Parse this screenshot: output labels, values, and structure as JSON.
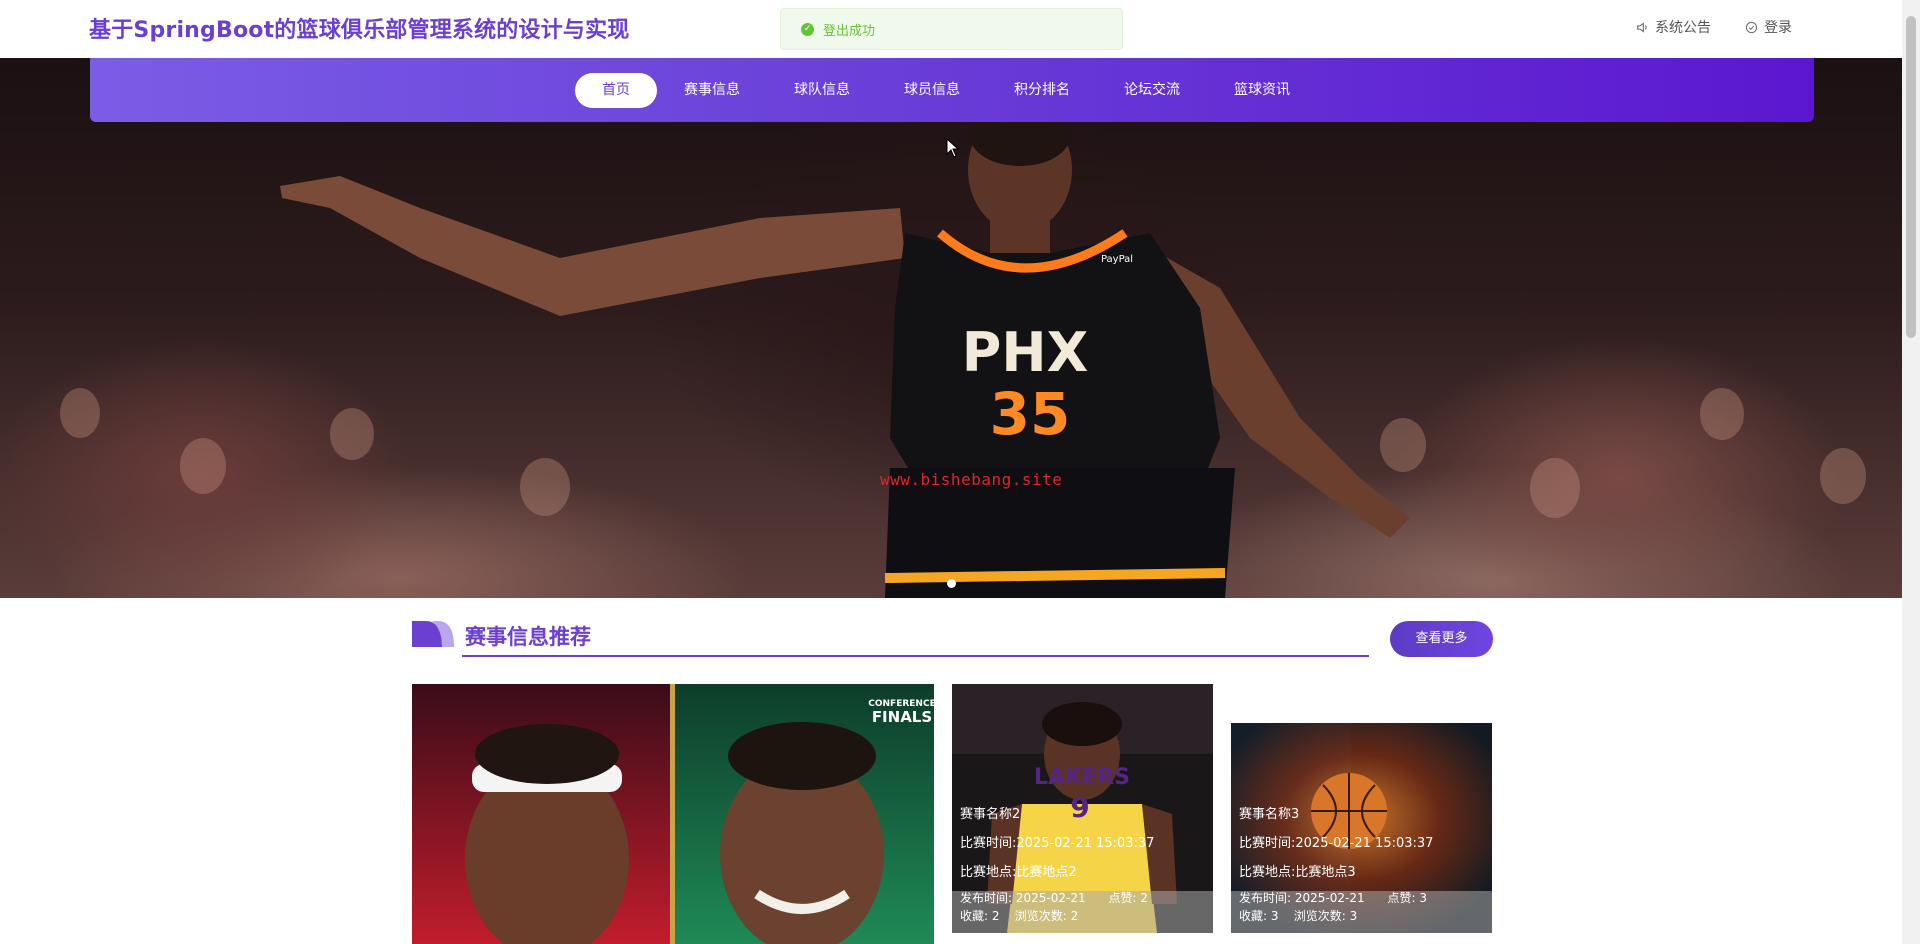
{
  "header": {
    "site_title": "基于SpringBoot的篮球俱乐部管理系统的设计与实现",
    "toast": "登出成功",
    "links": [
      {
        "label": "系统公告",
        "icon": "speaker-icon"
      },
      {
        "label": "登录",
        "icon": "check-circle-icon"
      }
    ]
  },
  "nav": {
    "items": [
      "首页",
      "赛事信息",
      "球队信息",
      "球员信息",
      "积分排名",
      "论坛交流",
      "篮球资讯"
    ],
    "active_index": 0
  },
  "hero": {
    "watermark": "www.bishebang.site",
    "jersey_team": "PHX",
    "jersey_number": "35",
    "sponsor": "PayPal"
  },
  "section": {
    "title": "赛事信息推荐",
    "more_button": "查看更多"
  },
  "cards": [
    {
      "badge_top": "CONFERENCE",
      "badge_bottom": "FINALS"
    },
    {
      "name": "赛事名称2",
      "time": "比赛时间:2025-02-21 15:03:37",
      "place": "比赛地点:比赛地点2",
      "publish": "发布时间:  2025-02-21",
      "likes": "点赞:  2",
      "favorites": "收藏:  2",
      "views": "浏览次数:  2",
      "jersey_team": "LAKERS",
      "jersey_number": "9"
    },
    {
      "name": "赛事名称3",
      "time": "比赛时间:2025-02-21 15:03:37",
      "place": "比赛地点:比赛地点3",
      "publish": "发布时间:  2025-02-21",
      "likes": "点赞:  3",
      "favorites": "收藏:  3",
      "views": "浏览次数:  3"
    }
  ],
  "colors": {
    "brand": "#6a3fd1",
    "toast_text": "#67c23a",
    "watermark": "#e0252b"
  }
}
